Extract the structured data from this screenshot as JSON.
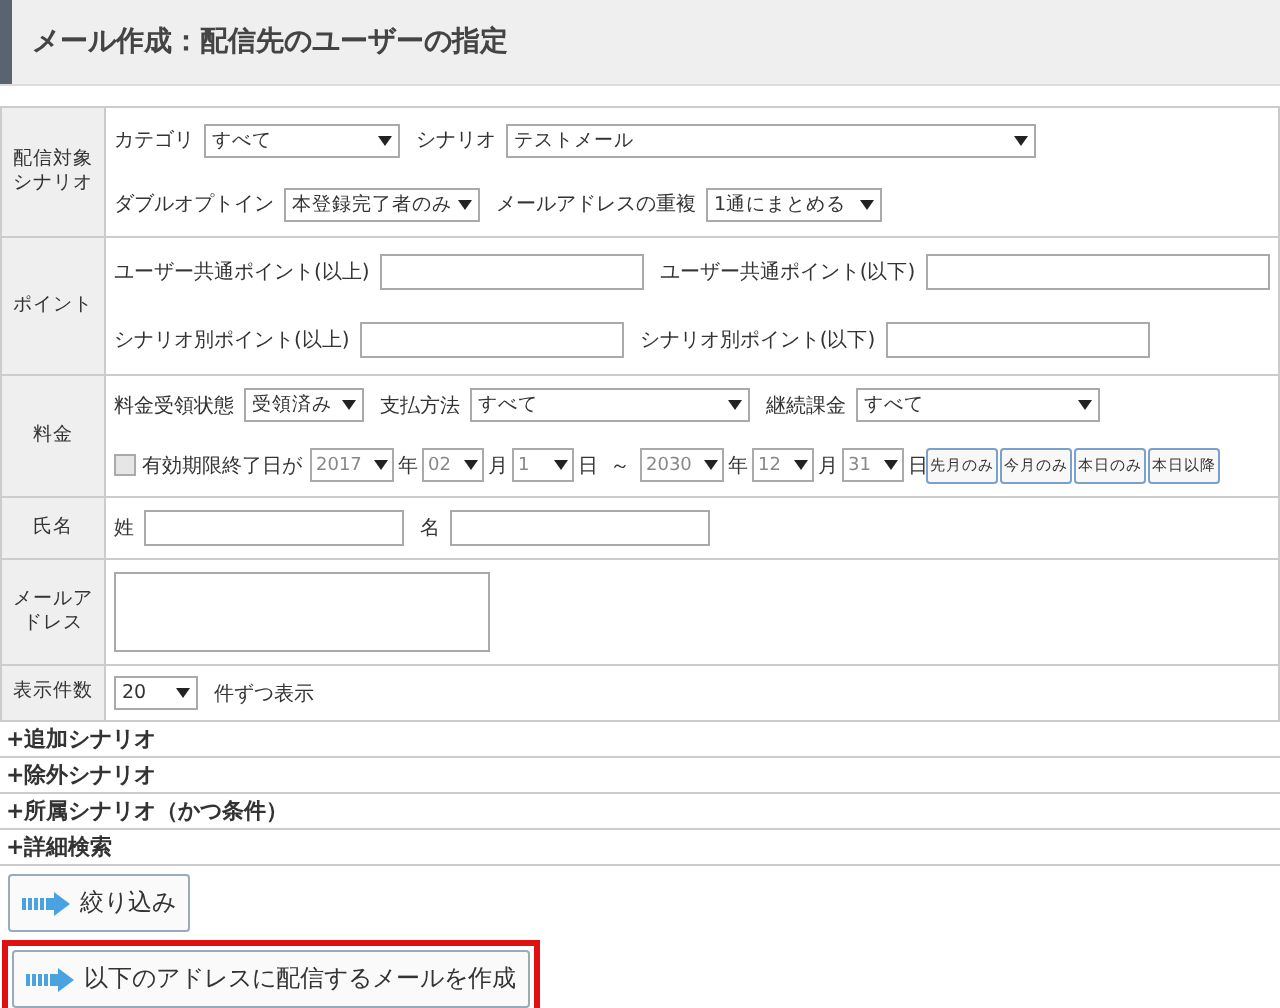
{
  "title": "メール作成：配信先のユーザーの指定",
  "rows": [
    {
      "label": "配信対象シナリオ",
      "lines": [
        [
          {
            "kind": "label",
            "text": "カテゴリ"
          },
          {
            "kind": "select",
            "value": "すべて"
          },
          {
            "kind": "label",
            "text": "シナリオ"
          },
          {
            "kind": "select",
            "value": "テストメール"
          }
        ],
        [
          {
            "kind": "label",
            "text": "ダブルオプトイン"
          },
          {
            "kind": "select",
            "value": "本登録完了者のみ"
          },
          {
            "kind": "label",
            "text": "メールアドレスの重複"
          },
          {
            "kind": "select",
            "value": "1通にまとめる"
          }
        ]
      ]
    },
    {
      "label": "ポイント",
      "lines": [
        [
          {
            "kind": "label",
            "text": "ユーザー共通ポイント(以上)"
          },
          {
            "kind": "input"
          },
          {
            "kind": "label",
            "text": "ユーザー共通ポイント(以下)"
          },
          {
            "kind": "input"
          }
        ],
        [
          {
            "kind": "label",
            "text": "シナリオ別ポイント(以上)"
          },
          {
            "kind": "input"
          },
          {
            "kind": "label",
            "text": "シナリオ別ポイント(以下)"
          },
          {
            "kind": "input"
          }
        ]
      ]
    },
    {
      "label": "料金",
      "lines": [
        [
          {
            "kind": "label",
            "text": "料金受領状態"
          },
          {
            "kind": "select",
            "value": "受領済み"
          },
          {
            "kind": "label",
            "text": "支払方法"
          },
          {
            "kind": "select",
            "value": "すべて"
          },
          {
            "kind": "label",
            "text": "継続課金"
          },
          {
            "kind": "select",
            "value": "すべて"
          }
        ],
        [
          {
            "kind": "checkbox",
            "text": "有効期限終了日が",
            "checked": false
          },
          {
            "kind": "select",
            "value": "2017"
          },
          {
            "kind": "unit",
            "text": "年"
          },
          {
            "kind": "select",
            "value": "02"
          },
          {
            "kind": "unit",
            "text": "月"
          },
          {
            "kind": "select",
            "value": "1"
          },
          {
            "kind": "unit",
            "text": "日"
          },
          {
            "kind": "label",
            "text": "～"
          },
          {
            "kind": "select",
            "value": "2030"
          },
          {
            "kind": "unit",
            "text": "年"
          },
          {
            "kind": "select",
            "value": "12"
          },
          {
            "kind": "unit",
            "text": "月"
          },
          {
            "kind": "select",
            "value": "31"
          },
          {
            "kind": "unit",
            "text": "日"
          },
          {
            "kind": "button",
            "text": "先月のみ"
          },
          {
            "kind": "button",
            "text": "今月のみ"
          },
          {
            "kind": "button",
            "text": "本日のみ"
          },
          {
            "kind": "button",
            "text": "本日以降"
          }
        ]
      ]
    },
    {
      "label": "氏名",
      "lines": [
        [
          {
            "kind": "label",
            "text": "姓"
          },
          {
            "kind": "input"
          },
          {
            "kind": "label",
            "text": "名"
          },
          {
            "kind": "input"
          }
        ]
      ]
    },
    {
      "label": "メールアドレス",
      "lines": [
        [
          {
            "kind": "textarea"
          }
        ]
      ]
    },
    {
      "label": "表示件数",
      "lines": [
        [
          {
            "kind": "select",
            "value": "20"
          },
          {
            "kind": "label",
            "text": "件ずつ表示"
          }
        ]
      ]
    }
  ],
  "sections": [
    {
      "label": "+追加シナリオ"
    },
    {
      "label": "+除外シナリオ"
    },
    {
      "label": "+所属シナリオ（かつ条件）"
    },
    {
      "label": "+詳細検索"
    }
  ],
  "actions": [
    {
      "label": "絞り込み",
      "highlighted": false
    },
    {
      "label": "以下のアドレスに配信するメールを作成",
      "highlighted": true
    }
  ]
}
